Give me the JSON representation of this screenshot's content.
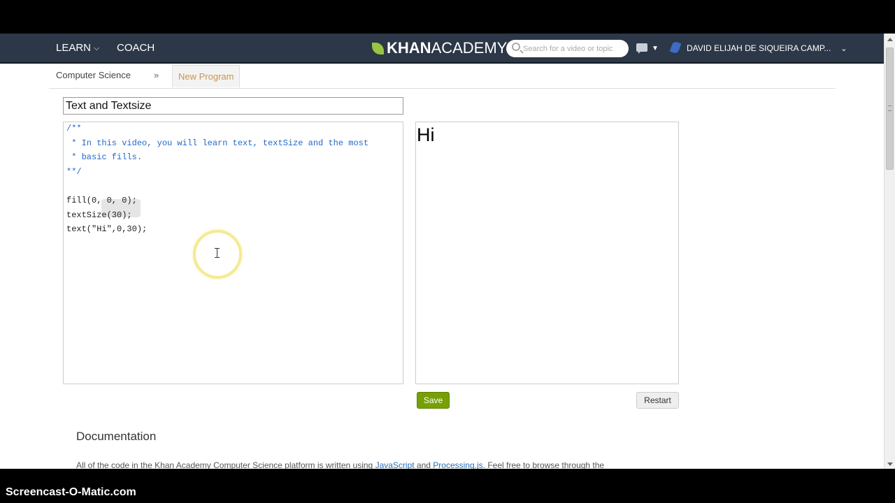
{
  "nav": {
    "learn_label": "LEARN",
    "coach_label": "COACH",
    "logo_bold": "KHAN",
    "logo_light": "ACADEMY",
    "search_placeholder": "Search for a video or topic",
    "user_name": "DAVID ELIJAH DE SIQUEIRA CAMP..."
  },
  "breadcrumb": {
    "parent": "Computer Science",
    "separator": "»",
    "current": "New Program"
  },
  "program": {
    "title": "Text and Textsize",
    "code_lines": [
      "/**",
      " * In this video, you will learn text, textSize and the most",
      " * basic fills.",
      "**/",
      "",
      "fill(0, 0, 0);",
      "textSize(30);",
      "text(\"Hi\",0,30);"
    ],
    "canvas_output": "Hi"
  },
  "actions": {
    "save_label": "Save",
    "restart_label": "Restart"
  },
  "documentation": {
    "title": "Documentation",
    "text_prefix": "All of the code in the Khan Academy Computer Science platform is written using ",
    "link1": "JavaScript",
    "text_mid": " and ",
    "link2": "Processing.js",
    "text_suffix": ". Feel free to browse through the"
  },
  "watermark": "Screencast-O-Matic.com"
}
